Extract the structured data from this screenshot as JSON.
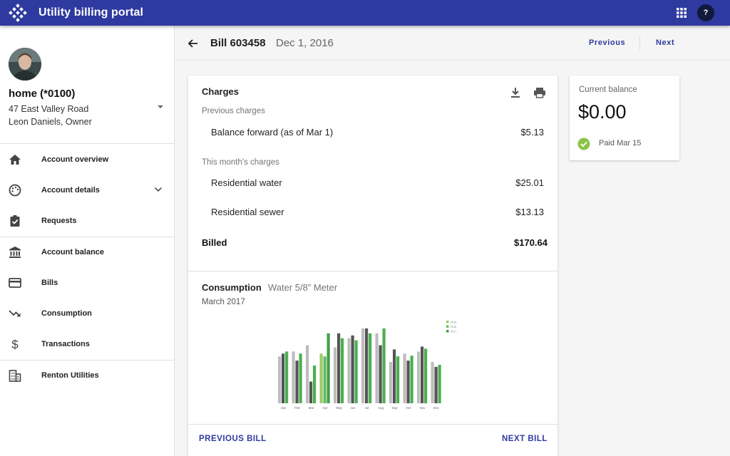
{
  "app": {
    "title": "Utility billing portal"
  },
  "colors": {
    "primary": "#2e3a9f",
    "paid_green": "#8bc34a",
    "chart_green": "#4caf50"
  },
  "profile": {
    "account_name": "home (*0100)",
    "address": "47 East Valley Road",
    "owner": "Leon Daniels, Owner"
  },
  "nav": [
    {
      "label": "Account overview",
      "icon": "home-icon"
    },
    {
      "label": "Account details",
      "icon": "palette-icon"
    },
    {
      "label": "Requests",
      "icon": "clipboard-check-icon"
    },
    {
      "label": "Account balance",
      "icon": "bank-icon"
    },
    {
      "label": "Bills",
      "icon": "credit-card-icon"
    },
    {
      "label": "Consumption",
      "icon": "trending-down-icon"
    },
    {
      "label": "Transactions",
      "icon": "dollar-icon"
    },
    {
      "label": "Renton Utilities",
      "icon": "building-icon"
    }
  ],
  "header": {
    "bill_number": "Bill 603458",
    "bill_date": "Dec 1, 2016",
    "previous": "Previous",
    "next": "Next"
  },
  "charges": {
    "title": "Charges",
    "previous_label": "Previous charges",
    "balance_forward": {
      "label": "Balance forward (as of Mar 1)",
      "amount": "$5.13"
    },
    "month_label": "This month's charges",
    "lines": [
      {
        "label": "Residential water",
        "amount": "$25.01"
      },
      {
        "label": "Residential sewer",
        "amount": "$13.13"
      }
    ],
    "billed": {
      "label": "Billed",
      "amount": "$170.64"
    }
  },
  "consumption": {
    "title": "Consumption",
    "meter": "Water 5/8” Meter",
    "period": "March 2017"
  },
  "footer": {
    "previous_bill": "PREVIOUS BILL",
    "next_bill": "NEXT BILL"
  },
  "balance": {
    "label": "Current balance",
    "amount": "$0.00",
    "paid": "Paid Mar 15"
  },
  "chart_data": {
    "type": "bar",
    "categories": [
      "Jan",
      "Feb",
      "Mar",
      "Apr",
      "May",
      "Jun",
      "Jul",
      "Aug",
      "Sep",
      "Oct",
      "Nov",
      "Dec"
    ],
    "series": [
      {
        "name": "2015",
        "values": [
          6.7,
          7.4,
          8.3,
          7.1,
          8.0,
          9.3,
          10.7,
          10.0,
          5.9,
          7.1,
          7.4,
          5.9
        ]
      },
      {
        "name": "2016",
        "values": [
          7.1,
          6.1,
          3.1,
          6.7,
          10.0,
          9.7,
          10.7,
          8.3,
          7.7,
          6.1,
          8.1,
          5.2
        ]
      },
      {
        "name": "2017",
        "values": [
          7.4,
          7.1,
          5.4,
          10.0,
          9.3,
          9.0,
          10.0,
          10.7,
          6.7,
          6.8,
          7.8,
          5.5
        ]
      }
    ],
    "series_colors": [
      "#bdbdbd",
      "#555555",
      "#4caf50"
    ],
    "highlight_category": "Apr",
    "highlight_colors": [
      "#9ccc65",
      "#66bb6a",
      "#43a047"
    ],
    "ylim": [
      0,
      11
    ],
    "legend": "top-right",
    "grid": false
  }
}
